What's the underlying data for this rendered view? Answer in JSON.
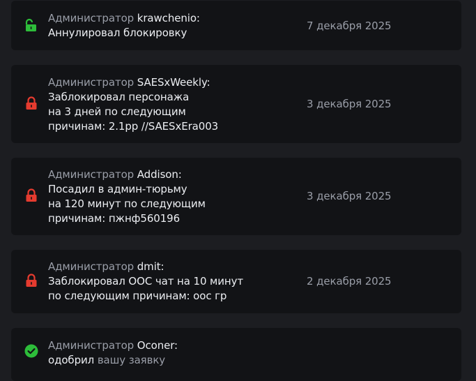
{
  "colors": {
    "background": "#1c1d21",
    "card": "#121316",
    "text": "#eceef2",
    "muted": "#9a9ea8",
    "unlock_green": "#2dbd3a",
    "lock_red": "#e53b2f",
    "approved_green": "#2dbd3a"
  },
  "role_label": "Администратор",
  "events": [
    {
      "icon": "unlock-icon",
      "admin": "krawchenio:",
      "lines": [
        "Аннулировал блокировку"
      ],
      "date": "7 декабря 2025"
    },
    {
      "icon": "lock-icon",
      "admin": "SAESxWeekly:",
      "lines": [
        "Заблокировал персонажа",
        "на 3 дней по следующим",
        "причинам: 2.1pp //SAESxEra003"
      ],
      "date": "3 декабря 2025"
    },
    {
      "icon": "lock-icon",
      "admin": "Addison:",
      "lines": [
        "Посадил в админ-тюрьму",
        "на 120 минут по следующим",
        "причинам: пжнф560196"
      ],
      "date": "3 декабря 2025"
    },
    {
      "icon": "lock-icon",
      "admin": "dmit:",
      "lines": [
        "Заблокировал ООС чат на 10 минут",
        "по следующим причинам: оос гр"
      ],
      "date": "2 декабря 2025"
    },
    {
      "icon": "check-circle-icon",
      "admin": "Oconer:",
      "lines": [
        "одобрил"
      ],
      "link": "вашу заявку"
    }
  ]
}
